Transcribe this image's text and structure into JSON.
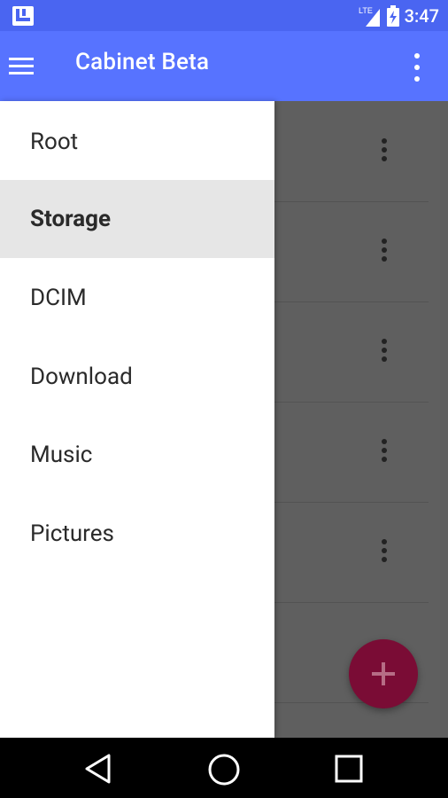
{
  "status_bar": {
    "time": "3:47",
    "network": "LTE",
    "left_icon": "app-notification-icon",
    "right_icons": [
      "lte-signal-icon",
      "battery-charging-icon"
    ]
  },
  "app_bar": {
    "title": "Cabinet Beta",
    "menu_icon": "menu-icon",
    "overflow_icon": "more-vert-icon",
    "color": "#5773ff"
  },
  "drawer": {
    "items": [
      {
        "label": "Root",
        "active": false
      },
      {
        "label": "Storage",
        "active": true
      },
      {
        "label": "DCIM",
        "active": false
      },
      {
        "label": "Download",
        "active": false
      },
      {
        "label": "Music",
        "active": false
      },
      {
        "label": "Pictures",
        "active": false
      }
    ]
  },
  "main": {
    "row_count": 5,
    "fab_icon": "add-icon",
    "fab_color": "#7a0c35"
  },
  "nav_bar": {
    "buttons": [
      "back-icon",
      "home-icon",
      "recents-icon"
    ]
  }
}
